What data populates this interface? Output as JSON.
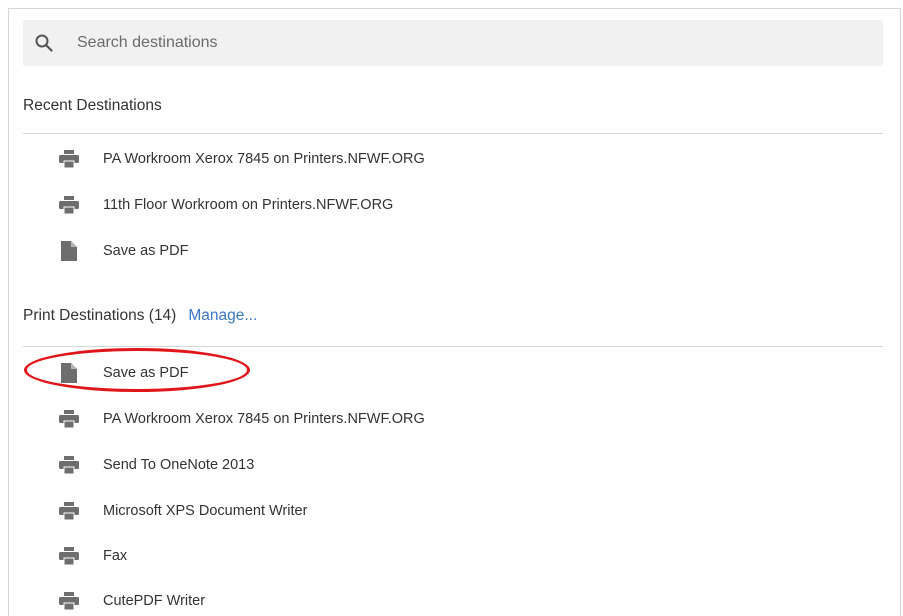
{
  "search": {
    "placeholder": "Search destinations",
    "icon": "search-icon"
  },
  "recent": {
    "header": "Recent Destinations",
    "items": [
      {
        "label": "PA Workroom Xerox 7845 on Printers.NFWF.ORG",
        "icon": "printer-icon"
      },
      {
        "label": "11th Floor Workroom on Printers.NFWF.ORG",
        "icon": "printer-icon"
      },
      {
        "label": "Save as PDF",
        "icon": "document-icon"
      }
    ]
  },
  "print": {
    "header": "Print Destinations (14)",
    "manage_label": "Manage...",
    "items": [
      {
        "label": "Save as PDF",
        "icon": "document-icon"
      },
      {
        "label": "PA Workroom Xerox 7845 on Printers.NFWF.ORG",
        "icon": "printer-icon"
      },
      {
        "label": "Send To OneNote 2013",
        "icon": "printer-icon"
      },
      {
        "label": "Microsoft XPS Document Writer",
        "icon": "printer-icon"
      },
      {
        "label": "Fax",
        "icon": "printer-icon"
      },
      {
        "label": "CutePDF Writer",
        "icon": "printer-icon"
      }
    ]
  },
  "colors": {
    "link": "#3b78c4",
    "icon_gray": "#6e6e6e",
    "highlight": "#e0161b"
  }
}
